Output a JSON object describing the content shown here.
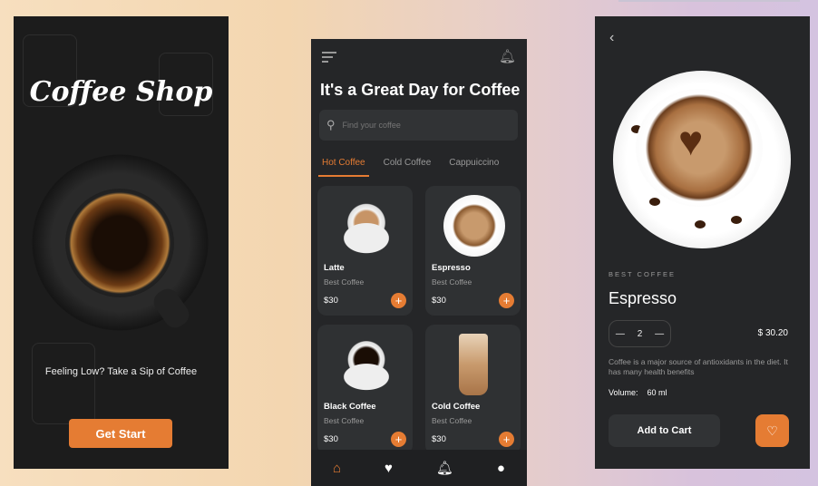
{
  "splash": {
    "logo": "Coffee Shop",
    "tagline": "Feeling Low? Take a Sip of Coffee",
    "button": "Get Start"
  },
  "home": {
    "title": "It's a Great Day for Coffee",
    "search_placeholder": "Find your coffee",
    "tabs": [
      {
        "label": "Hot Coffee",
        "active": true
      },
      {
        "label": "Cold Coffee"
      },
      {
        "label": "Cappuiccino"
      }
    ],
    "products": [
      {
        "name": "Latte",
        "subtitle": "Best Coffee",
        "price": "$30"
      },
      {
        "name": "Espresso",
        "subtitle": "Best Coffee",
        "price": "$30"
      },
      {
        "name": "Black Coffee",
        "subtitle": "Best Coffee",
        "price": "$30"
      },
      {
        "name": "Cold Coffee",
        "subtitle": "Best Coffee",
        "price": "$30"
      }
    ],
    "add_icon": "+",
    "nav": [
      "home-icon",
      "heart-icon",
      "bell-icon",
      "user-icon"
    ]
  },
  "detail": {
    "category": "BEST COFFEE",
    "name": "Espresso",
    "quantity": "2",
    "price": "$ 30.20",
    "description": "Coffee is a major source of antioxidants in the diet. It has many health benefits",
    "volume_label": "Volume:",
    "volume": "60 ml",
    "add_to_cart": "Add to Cart"
  },
  "colors": {
    "accent": "#e57c33",
    "panel": "#252628"
  }
}
